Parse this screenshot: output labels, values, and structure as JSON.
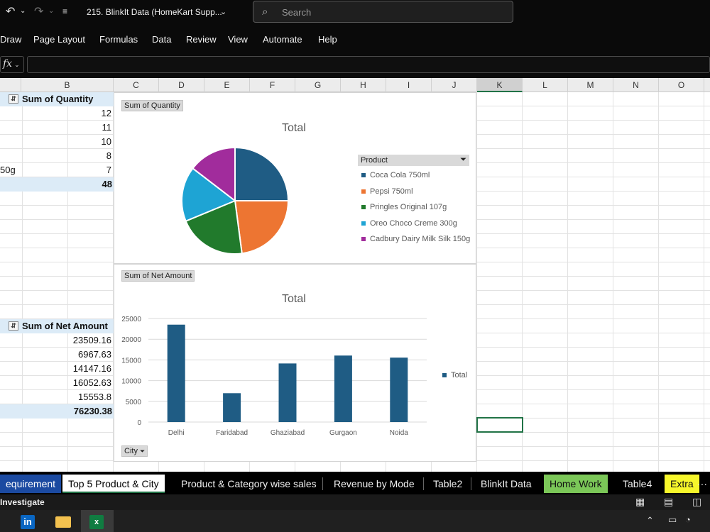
{
  "title_bar": {
    "doc_title": "215. BlinkIt Data (HomeKart Supp...",
    "search_placeholder": "Search"
  },
  "menu": [
    "Draw",
    "Page Layout",
    "Formulas",
    "Data",
    "Review",
    "View",
    "Automate",
    "Help"
  ],
  "formula_bar": {
    "fx_label": "fx"
  },
  "columns": [
    "B",
    "C",
    "D",
    "E",
    "F",
    "G",
    "H",
    "I",
    "J",
    "K",
    "L",
    "M",
    "N",
    "O"
  ],
  "selected_column": "K",
  "pivot_quantity": {
    "header": "Sum of Quantity",
    "values": [
      "12",
      "11",
      "10",
      "8",
      "7"
    ],
    "row_label_fragment": "50g",
    "total": "48"
  },
  "pivot_net_amount": {
    "header": "Sum of Net Amount",
    "values": [
      "23509.16",
      "6967.63",
      "14147.16",
      "16052.63",
      "15553.8"
    ],
    "total": "76230.38"
  },
  "pie_chart": {
    "field_button": "Sum of Quantity",
    "title": "Total",
    "legend_header": "Product",
    "chart_data": {
      "type": "pie",
      "title": "Total",
      "categories": [
        "Coca Cola 750ml",
        "Pepsi 750ml",
        "Pringles Original 107g",
        "Oreo Choco Creme 300g",
        "Cadbury Dairy Milk Silk 150g"
      ],
      "values": [
        12,
        11,
        10,
        8,
        7
      ],
      "colors": [
        "#1f5c84",
        "#ed7532",
        "#217a2c",
        "#1ea4d4",
        "#a12c9c"
      ]
    }
  },
  "bar_chart": {
    "field_button": "Sum of Net Amount",
    "title": "Total",
    "legend_label": "Total",
    "axis_button": "City",
    "chart_data": {
      "type": "bar",
      "title": "Total",
      "categories": [
        "Delhi",
        "Faridabad",
        "Ghaziabad",
        "Gurgaon",
        "Noida"
      ],
      "series": [
        {
          "name": "Total",
          "values": [
            23509.16,
            6967.63,
            14147.16,
            16052.63,
            15553.8
          ]
        }
      ],
      "yticks": [
        "25000",
        "20000",
        "15000",
        "10000",
        "5000",
        "0"
      ],
      "ylim": [
        0,
        25000
      ],
      "color": "#1f5c84"
    }
  },
  "sheet_tabs": [
    {
      "label": "equirement",
      "style": "blue"
    },
    {
      "label": "Top 5 Product & City",
      "style": "active"
    },
    {
      "label": "Product & Category wise sales",
      "style": "plain"
    },
    {
      "label": "Revenue by Mode",
      "style": "plain"
    },
    {
      "label": "Table2",
      "style": "plain"
    },
    {
      "label": "BlinkIt Data",
      "style": "plain"
    },
    {
      "label": "Home Work",
      "style": "green"
    },
    {
      "label": "Table4",
      "style": "plain"
    },
    {
      "label": "Extra",
      "style": "yellow"
    }
  ],
  "more_tabs": "···",
  "status_bar": {
    "left_text": "Investigate"
  }
}
